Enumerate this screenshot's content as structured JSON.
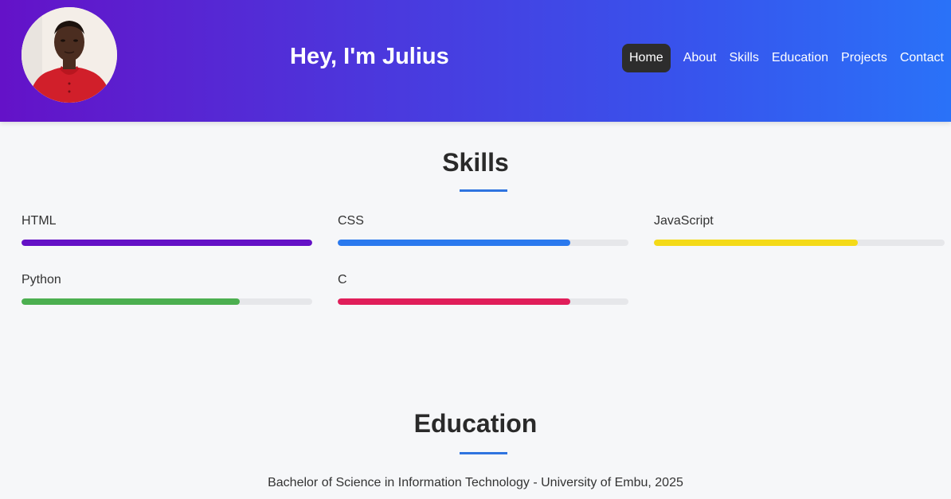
{
  "header": {
    "title": "Hey, I'm Julius",
    "avatar_alt": "profile photo",
    "nav": [
      {
        "label": "Home",
        "active": true
      },
      {
        "label": "About",
        "active": false
      },
      {
        "label": "Skills",
        "active": false
      },
      {
        "label": "Education",
        "active": false
      },
      {
        "label": "Projects",
        "active": false
      },
      {
        "label": "Contact",
        "active": false
      }
    ]
  },
  "skills": {
    "title": "Skills",
    "items": [
      {
        "name": "HTML",
        "level_percent": 100,
        "color": "#6411c6"
      },
      {
        "name": "CSS",
        "level_percent": 80,
        "color": "#2a79ee"
      },
      {
        "name": "JavaScript",
        "level_percent": 70,
        "color": "#f4da18"
      },
      {
        "name": "Python",
        "level_percent": 75,
        "color": "#4caf50"
      },
      {
        "name": "C",
        "level_percent": 80,
        "color": "#e01e5a"
      }
    ]
  },
  "education": {
    "title": "Education",
    "items": [
      "Bachelor of Science in Information Technology - University of Embu, 2025"
    ]
  }
}
